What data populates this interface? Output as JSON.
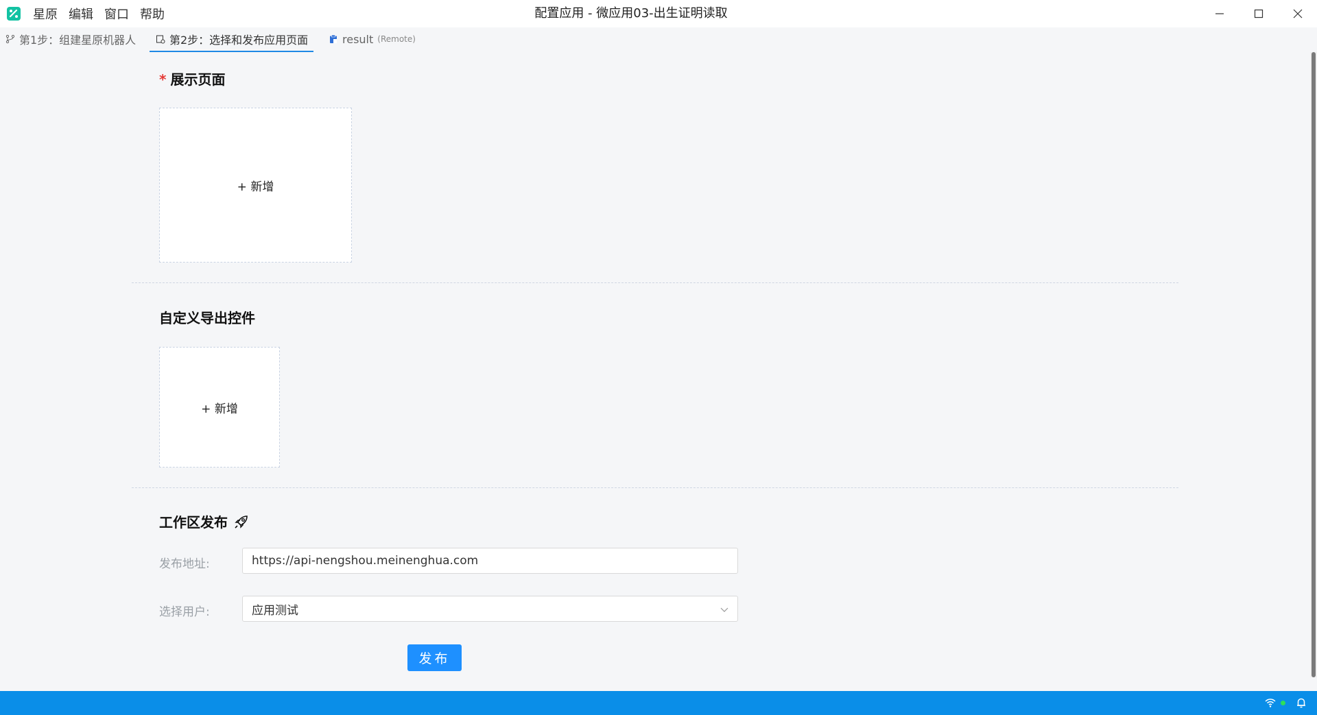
{
  "titlebar": {
    "menu": [
      "星原",
      "编辑",
      "窗口",
      "帮助"
    ],
    "title": "配置应用 - 微应用03-出生证明读取"
  },
  "tabs": [
    {
      "label": "第1步：组建星原机器人",
      "icon": "branch-icon",
      "active": false
    },
    {
      "label": "第2步：选择和发布应用页面",
      "icon": "page-settings-icon",
      "active": true
    },
    {
      "label": "result",
      "sub": "(Remote)",
      "icon": "clipboard-icon",
      "active": false
    }
  ],
  "display_page": {
    "required_star": "*",
    "title": "展示页面",
    "add_label": "+ 新增"
  },
  "custom_export": {
    "title": "自定义导出控件",
    "add_label": "+ 新增"
  },
  "workspace_publish": {
    "title": "工作区发布",
    "icon": "rocket-icon",
    "address_label": "发布地址:",
    "address_value": "https://api-nengshou.meinenghua.com",
    "user_label": "选择用户:",
    "user_value": "应用测试",
    "publish_button": "发布"
  },
  "colors": {
    "accent": "#1e90ff",
    "statusbar": "#0a8ee8",
    "required": "#e53935"
  }
}
